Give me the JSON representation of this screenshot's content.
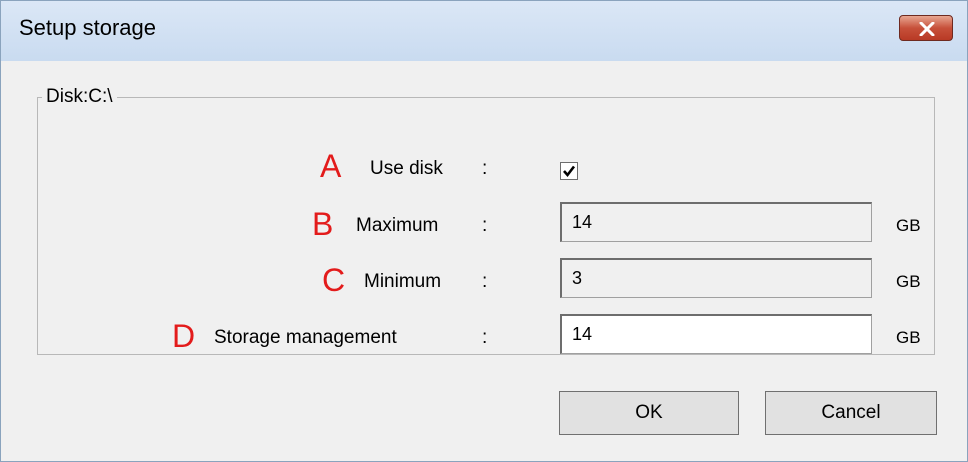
{
  "window": {
    "title": "Setup storage"
  },
  "group": {
    "legend": "Disk:C:\\"
  },
  "rows": {
    "use_disk": {
      "marker": "A",
      "label": "Use disk",
      "colon": ":",
      "checked": true
    },
    "maximum": {
      "marker": "B",
      "label": "Maximum",
      "colon": ":",
      "value": "14",
      "unit": "GB",
      "enabled": false
    },
    "minimum": {
      "marker": "C",
      "label": "Minimum",
      "colon": ":",
      "value": "3",
      "unit": "GB",
      "enabled": false
    },
    "storage_management": {
      "marker": "D",
      "label": "Storage management",
      "colon": ":",
      "value": "14",
      "unit": "GB",
      "enabled": true
    }
  },
  "buttons": {
    "ok": "OK",
    "cancel": "Cancel"
  },
  "colors": {
    "marker": "#e31b1b",
    "close_button": "#c7503a",
    "titlebar": "#dbe7f6"
  },
  "icons": {
    "close": "close-x-icon",
    "check": "checkmark-icon"
  }
}
